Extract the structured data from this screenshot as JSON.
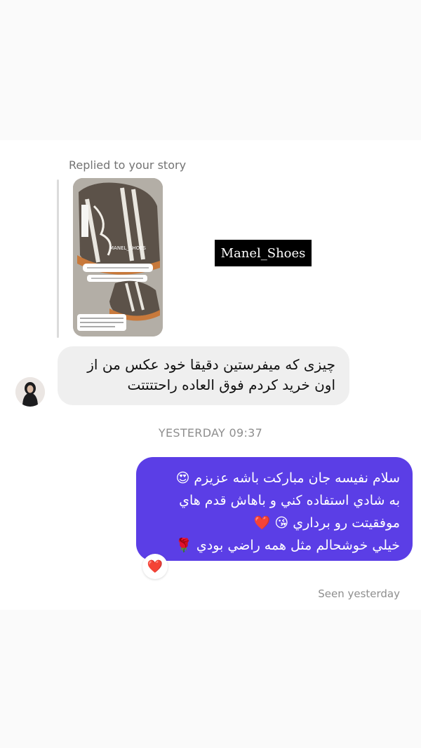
{
  "reply": {
    "label": "Replied to your story"
  },
  "story": {
    "brand_tag": "Manel_Shoes",
    "thumb_watermark": "MANEL_SHOES"
  },
  "incoming": {
    "lines": [
      "چیزی که میفرستین دقیقا خود عکس من از",
      "اون خرید کردم فوق العاده راحتتتتت"
    ]
  },
  "timestamp": "YESTERDAY 09:37",
  "outgoing": {
    "lines": [
      "سلام نفيسه جان مباركت باشه عزيزم 😍",
      "به شادي استفاده كني و باهاش قدم هاي",
      "موفقيتت رو برداري 😘 ❤️",
      "خيلي خوشحالم مثل همه راضي بودي 🌹"
    ]
  },
  "reaction": {
    "emoji": "❤️",
    "icon": "heart-icon"
  },
  "status": {
    "seen": "Seen yesterday"
  },
  "colors": {
    "outgoing_bubble": "#5b3ee6",
    "incoming_bubble": "#efefef",
    "meta_text": "#8e8e8e"
  }
}
